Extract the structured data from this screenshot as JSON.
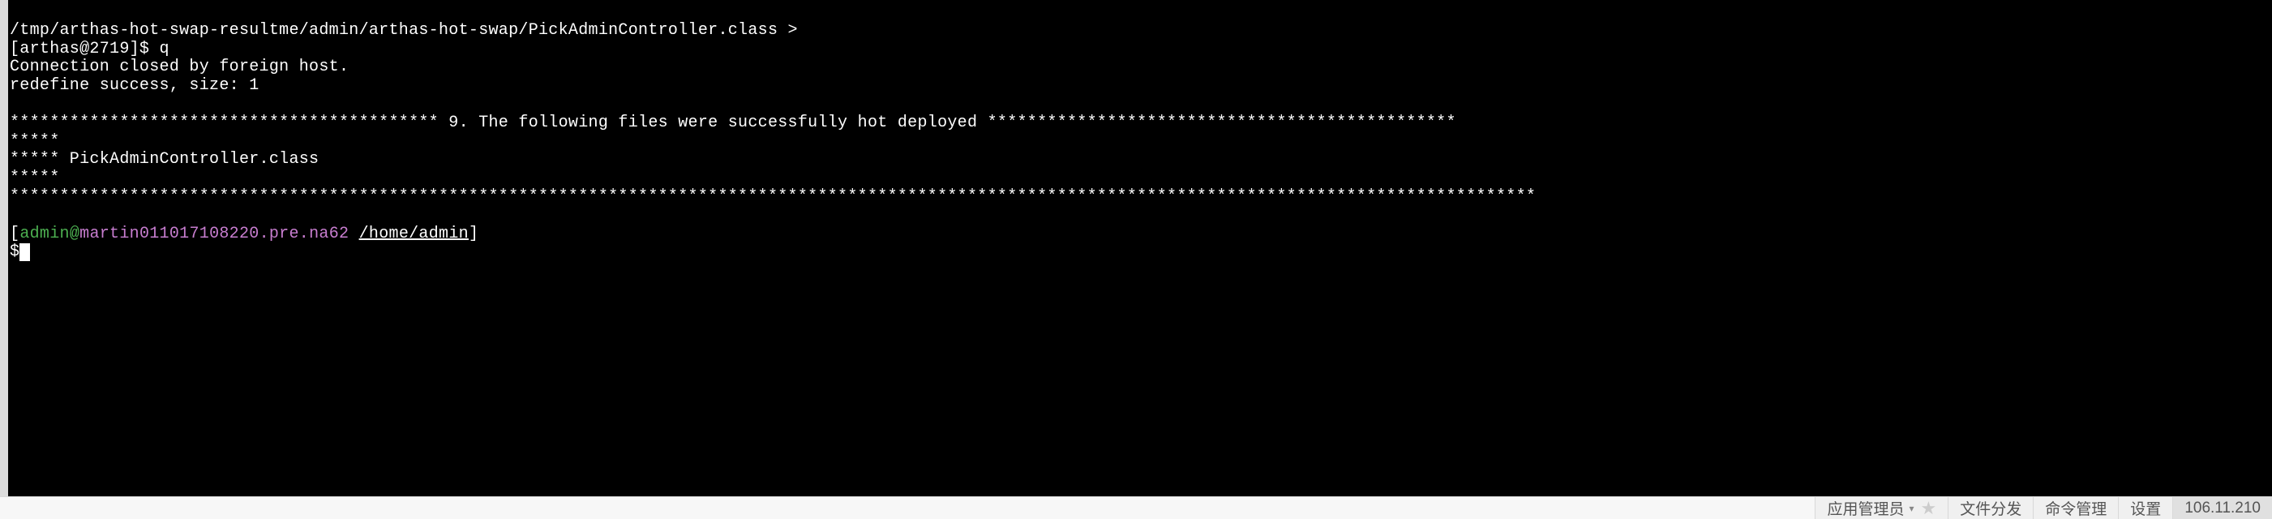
{
  "terminal": {
    "lines": [
      "/tmp/arthas-hot-swap-resultme/admin/arthas-hot-swap/PickAdminController.class >",
      "[arthas@2719]$ q",
      "Connection closed by foreign host.",
      "redefine success, size: 1",
      "",
      "******************************************* 9. The following files were successfully hot deployed ***********************************************",
      "*****",
      "***** PickAdminController.class",
      "*****",
      "*********************************************************************************************************************************************************",
      ""
    ],
    "prompt": {
      "open_bracket": "[",
      "user": "admin",
      "at": "@",
      "host": "martin011017108220.pre.na62",
      "space": " ",
      "path": "/home/admin",
      "close_bracket": "]",
      "dollar": "$"
    }
  },
  "bottomBar": {
    "role": "应用管理员",
    "fileDispatch": "文件分发",
    "commandMgmt": "命令管理",
    "settings": "设置",
    "ip": "106.11.210"
  }
}
